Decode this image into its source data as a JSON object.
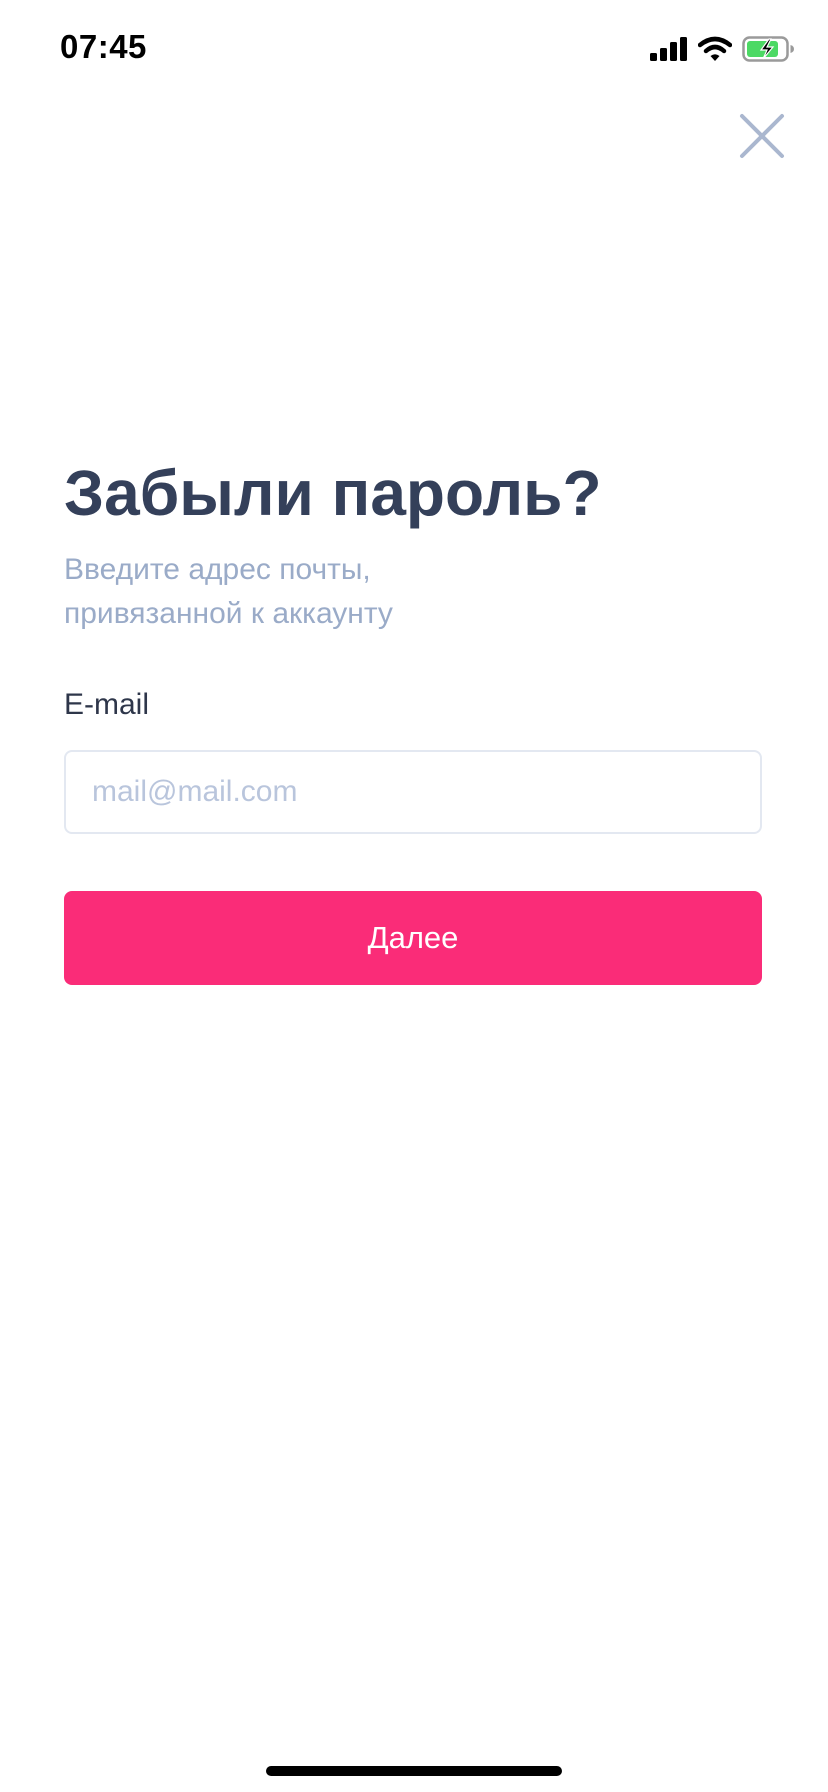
{
  "status_bar": {
    "time": "07:45",
    "icons": [
      "cellular-signal-icon",
      "wifi-icon",
      "battery-charging-icon"
    ]
  },
  "close_button": {
    "icon": "close-icon"
  },
  "forgot_password": {
    "title": "Забыли пароль?",
    "subtitle_line1": "Введите адрес почты,",
    "subtitle_line2": "привязанной к аккаунту",
    "email_label": "E-mail",
    "email_value": "",
    "email_placeholder": "mail@mail.com",
    "submit_label": "Далее"
  },
  "colors": {
    "accent": "#fa2c78",
    "title": "#34405a",
    "subtitle": "#9aabc8",
    "input_border": "#e3e8f1",
    "icon": "#aab7cf",
    "battery_fill": "#4cd964"
  }
}
